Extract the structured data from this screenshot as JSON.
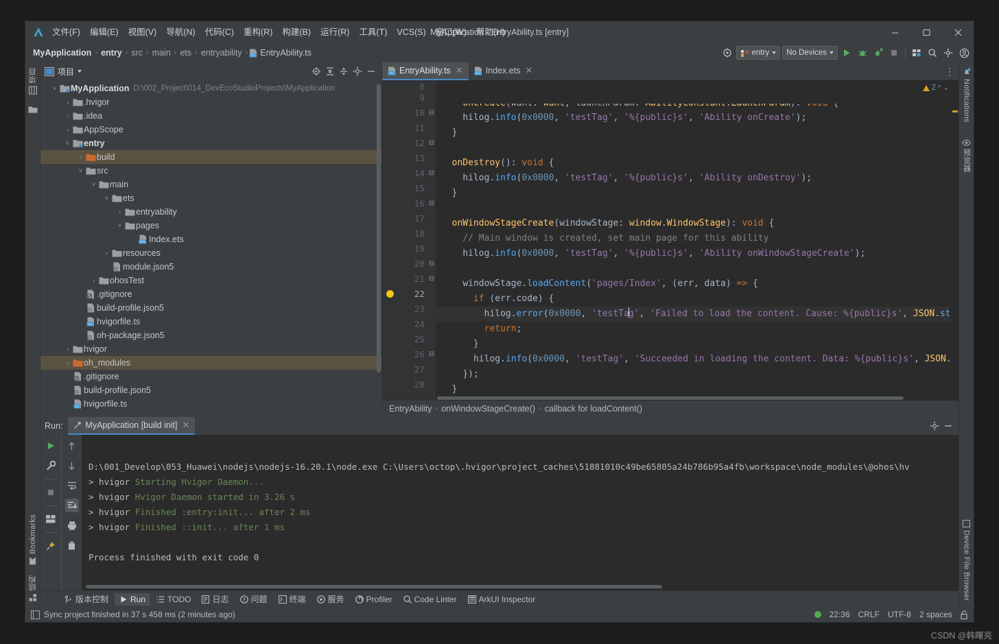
{
  "window": {
    "title": "MyApplication - EntryAbility.ts [entry]",
    "minimize_label": "─",
    "maximize_label": "☐",
    "close_label": "✕"
  },
  "menu": {
    "items": [
      {
        "label": "文件(F)",
        "name": "menu-file"
      },
      {
        "label": "编辑(E)",
        "name": "menu-edit"
      },
      {
        "label": "视图(V)",
        "name": "menu-view"
      },
      {
        "label": "导航(N)",
        "name": "menu-navigate"
      },
      {
        "label": "代码(C)",
        "name": "menu-code"
      },
      {
        "label": "重构(R)",
        "name": "menu-refactor"
      },
      {
        "label": "构建(B)",
        "name": "menu-build"
      },
      {
        "label": "运行(R)",
        "name": "menu-run"
      },
      {
        "label": "工具(T)",
        "name": "menu-tools"
      },
      {
        "label": "VCS(S)",
        "name": "menu-vcs"
      },
      {
        "label": "窗口(W)",
        "name": "menu-window"
      },
      {
        "label": "帮助(H)",
        "name": "menu-help"
      }
    ]
  },
  "navbar": {
    "crumbs": [
      "MyApplication",
      "entry",
      "src",
      "main",
      "ets",
      "entryability"
    ],
    "file": "EntryAbility.ts",
    "separator": "›",
    "run_config": "entry",
    "device": "No Devices"
  },
  "project_panel": {
    "title": "项目",
    "tree": [
      {
        "depth": 0,
        "arrow": "v",
        "icon": "module",
        "label": "MyApplication",
        "bold": true,
        "path": "D:\\002_Project\\014_DevEcoStudioProjects\\MyApplication",
        "selected": false
      },
      {
        "depth": 1,
        "arrow": ">",
        "icon": "folder",
        "label": ".hvigor",
        "bold": false,
        "path": "",
        "selected": false
      },
      {
        "depth": 1,
        "arrow": ">",
        "icon": "folder",
        "label": ".idea",
        "bold": false,
        "path": "",
        "selected": false
      },
      {
        "depth": 1,
        "arrow": ">",
        "icon": "folder",
        "label": "AppScope",
        "bold": false,
        "path": "",
        "selected": false
      },
      {
        "depth": 1,
        "arrow": "v",
        "icon": "module",
        "label": "entry",
        "bold": true,
        "path": "",
        "selected": false
      },
      {
        "depth": 2,
        "arrow": ">",
        "icon": "folder-orange",
        "label": "build",
        "bold": false,
        "path": "",
        "selected": true
      },
      {
        "depth": 2,
        "arrow": "v",
        "icon": "folder",
        "label": "src",
        "bold": false,
        "path": "",
        "selected": false
      },
      {
        "depth": 3,
        "arrow": "v",
        "icon": "folder",
        "label": "main",
        "bold": false,
        "path": "",
        "selected": false
      },
      {
        "depth": 4,
        "arrow": "v",
        "icon": "folder",
        "label": "ets",
        "bold": false,
        "path": "",
        "selected": false
      },
      {
        "depth": 5,
        "arrow": ">",
        "icon": "folder",
        "label": "entryability",
        "bold": false,
        "path": "",
        "selected": false
      },
      {
        "depth": 5,
        "arrow": "v",
        "icon": "folder",
        "label": "pages",
        "bold": false,
        "path": "",
        "selected": false
      },
      {
        "depth": 6,
        "arrow": "",
        "icon": "ets-file",
        "label": "Index.ets",
        "bold": false,
        "path": "",
        "selected": false
      },
      {
        "depth": 4,
        "arrow": ">",
        "icon": "folder",
        "label": "resources",
        "bold": false,
        "path": "",
        "selected": false
      },
      {
        "depth": 4,
        "arrow": "",
        "icon": "json-file",
        "label": "module.json5",
        "bold": false,
        "path": "",
        "selected": false
      },
      {
        "depth": 3,
        "arrow": ">",
        "icon": "folder",
        "label": "ohosTest",
        "bold": false,
        "path": "",
        "selected": false
      },
      {
        "depth": 2,
        "arrow": "",
        "icon": "git-file",
        "label": ".gitignore",
        "bold": false,
        "path": "",
        "selected": false
      },
      {
        "depth": 2,
        "arrow": "",
        "icon": "json-file",
        "label": "build-profile.json5",
        "bold": false,
        "path": "",
        "selected": false
      },
      {
        "depth": 2,
        "arrow": "",
        "icon": "ts-file",
        "label": "hvigorfile.ts",
        "bold": false,
        "path": "",
        "selected": false
      },
      {
        "depth": 2,
        "arrow": "",
        "icon": "json-file",
        "label": "oh-package.json5",
        "bold": false,
        "path": "",
        "selected": false
      },
      {
        "depth": 1,
        "arrow": ">",
        "icon": "folder",
        "label": "hvigor",
        "bold": false,
        "path": "",
        "selected": false
      },
      {
        "depth": 1,
        "arrow": ">",
        "icon": "folder-orange",
        "label": "oh_modules",
        "bold": false,
        "path": "",
        "selected": true
      },
      {
        "depth": 1,
        "arrow": "",
        "icon": "git-file",
        "label": ".gitignore",
        "bold": false,
        "path": "",
        "selected": false
      },
      {
        "depth": 1,
        "arrow": "",
        "icon": "json-file",
        "label": "build-profile.json5",
        "bold": false,
        "path": "",
        "selected": false
      },
      {
        "depth": 1,
        "arrow": "",
        "icon": "ts-file",
        "label": "hvigorfile.ts",
        "bold": false,
        "path": "",
        "selected": false
      }
    ]
  },
  "editor": {
    "tabs": [
      {
        "label": "EntryAbility.ts",
        "icon": "ts-file",
        "active": true
      },
      {
        "label": "Index.ets",
        "icon": "ets-file",
        "active": false
      }
    ],
    "warning_count": "2",
    "line_start": 8,
    "lines": [
      {
        "n": 8,
        "fold": "",
        "marker": "",
        "html": "    <span class='fn'>onCreate</span><span class='bl'>(</span><span class='id'>want</span><span class='bl'>: </span><span class='fn'>Want</span><span class='bl'>, </span><span class='id'>launchParam</span><span class='bl'>: </span><span class='fn'>AbilityConstant</span><span class='bl'>.</span><span class='fn'>LaunchParam</span><span class='bl'>)</span><span class='bl'>: </span><span class='kw'>void</span> <span class='bl'>{</span>",
        "clipped": true
      },
      {
        "n": 9,
        "fold": "",
        "marker": "",
        "html": "    <span class='id'>hilog</span><span class='bl'>.</span><span class='meth'>info</span><span class='bl'>(</span><span class='num'>0x0000</span><span class='bl'>, </span><span class='str'>'testTag'</span><span class='bl'>, </span><span class='str'>'%{public}s'</span><span class='bl'>, </span><span class='str'>'Ability onCreate'</span><span class='bl'>);</span>"
      },
      {
        "n": 10,
        "fold": "-",
        "marker": "",
        "html": "  <span class='bl'>}</span>"
      },
      {
        "n": 11,
        "fold": "",
        "marker": "",
        "html": ""
      },
      {
        "n": 12,
        "fold": "-",
        "marker": "",
        "html": "  <span class='fn'>onDestroy</span><span class='bl'>()</span><span class='bl'>: </span><span class='kw'>void</span> <span class='bl'>{</span>"
      },
      {
        "n": 13,
        "fold": "",
        "marker": "",
        "html": "    <span class='id'>hilog</span><span class='bl'>.</span><span class='meth'>info</span><span class='bl'>(</span><span class='num'>0x0000</span><span class='bl'>, </span><span class='str'>'testTag'</span><span class='bl'>, </span><span class='str'>'%{public}s'</span><span class='bl'>, </span><span class='str'>'Ability onDestroy'</span><span class='bl'>);</span>"
      },
      {
        "n": 14,
        "fold": "-",
        "marker": "",
        "html": "  <span class='bl'>}</span>"
      },
      {
        "n": 15,
        "fold": "",
        "marker": "",
        "html": ""
      },
      {
        "n": 16,
        "fold": "-",
        "marker": "",
        "html": "  <span class='fn'>onWindowStageCreate</span><span class='bl'>(</span><span class='id'>windowStage</span><span class='bl'>: </span><span class='fn'>window</span><span class='bl'>.</span><span class='fn'>WindowStage</span><span class='bl'>)</span><span class='bl'>: </span><span class='kw'>void</span> <span class='bl'>{</span>"
      },
      {
        "n": 17,
        "fold": "",
        "marker": "",
        "html": "    <span class='cmt'>// Main window is created, set main page for this ability</span>"
      },
      {
        "n": 18,
        "fold": "",
        "marker": "",
        "html": "    <span class='id'>hilog</span><span class='bl'>.</span><span class='meth'>info</span><span class='bl'>(</span><span class='num'>0x0000</span><span class='bl'>, </span><span class='str'>'testTag'</span><span class='bl'>, </span><span class='str'>'%{public}s'</span><span class='bl'>, </span><span class='str'>'Ability onWindowStageCreate'</span><span class='bl'>);</span>"
      },
      {
        "n": 19,
        "fold": "",
        "marker": "",
        "html": ""
      },
      {
        "n": 20,
        "fold": "-",
        "marker": "",
        "html": "    <span class='id'>windowStage</span><span class='bl'>.</span><span class='meth'>loadContent</span><span class='bl'>(</span><span class='str'>'pages/Index'</span><span class='bl'>, (</span><span class='id'>err</span><span class='bl'>, </span><span class='id'>data</span><span class='bl'>) </span><span class='kw'>=&gt;</span> <span class='bl'>{</span>"
      },
      {
        "n": 21,
        "fold": "-",
        "marker": "",
        "html": "      <span class='kw'>if</span> <span class='bl'>(</span><span class='id'>err</span><span class='bl'>.</span><span class='id'>code</span><span class='bl'>) {</span>"
      },
      {
        "n": 22,
        "fold": "",
        "marker": "bulb",
        "html": "        <span class='id'>hilog</span><span class='bl'>.</span><span class='meth'>error</span><span class='bl'>(</span><span class='num'>0x0000</span><span class='bl'>, </span><span class='str'>'testTa</span><span class='cursor'></span><span class='str'>g'</span><span class='bl'>, </span><span class='str'>'Failed to load the content. Cause: %{public}s'</span><span class='bl'>, </span><span class='fn'>JSON</span><span class='bl'>.</span><span class='meth'>string</span>",
        "current": true,
        "clipped": true
      },
      {
        "n": 23,
        "fold": "",
        "marker": "",
        "html": "        <span class='kw'>return</span><span class='bl'>;</span>"
      },
      {
        "n": 24,
        "fold": "",
        "marker": "",
        "html": "      <span class='bl'>}</span>"
      },
      {
        "n": 25,
        "fold": "",
        "marker": "",
        "html": "      <span class='id'>hilog</span><span class='bl'>.</span><span class='meth'>info</span><span class='bl'>(</span><span class='num'>0x0000</span><span class='bl'>, </span><span class='str'>'testTag'</span><span class='bl'>, </span><span class='str'>'Succeeded in loading the content. Data: %{public}s'</span><span class='bl'>, </span><span class='fn'>JSON</span><span class='bl'>.</span><span class='meth'>stri</span>",
        "clipped": true
      },
      {
        "n": 26,
        "fold": "-",
        "marker": "",
        "html": "    <span class='bl'>});</span>"
      },
      {
        "n": 27,
        "fold": "",
        "marker": "",
        "html": "  <span class='bl'>}</span>"
      },
      {
        "n": 28,
        "fold": "",
        "marker": "",
        "html": ""
      }
    ],
    "breadcrumbs": [
      "EntryAbility",
      "onWindowStageCreate()",
      "callback for loadContent()"
    ]
  },
  "run_panel": {
    "label": "Run:",
    "tab": "MyApplication [build init]",
    "console": [
      {
        "parts": [
          {
            "t": "D:\\001_Develop\\053_Huawei\\nodejs\\nodejs-16.20.1\\node.exe C:\\Users\\octop\\.hvigor\\project_caches\\51881010c49be65805a24b786b95a4fb\\workspace\\node_modules\\@ohos\\hv",
            "c": "w"
          }
        ]
      },
      {
        "parts": [
          {
            "t": "> hvigor ",
            "c": "w"
          },
          {
            "t": "Starting Hvigor Daemon...",
            "c": "g"
          }
        ]
      },
      {
        "parts": [
          {
            "t": "> hvigor ",
            "c": "w"
          },
          {
            "t": "Hvigor Daemon started in 3.26 s",
            "c": "g"
          }
        ]
      },
      {
        "parts": [
          {
            "t": "> hvigor ",
            "c": "w"
          },
          {
            "t": "Finished :entry:init... after 2 ms",
            "c": "g"
          }
        ]
      },
      {
        "parts": [
          {
            "t": "> hvigor ",
            "c": "w"
          },
          {
            "t": "Finished ::init... after 1 ms",
            "c": "g"
          }
        ]
      },
      {
        "parts": [
          {
            "t": "",
            "c": "w"
          }
        ]
      },
      {
        "parts": [
          {
            "t": "Process finished with exit code 0",
            "c": "w"
          }
        ]
      }
    ]
  },
  "bottom_tabs": [
    {
      "label": "版本控制",
      "icon": "branch-icon",
      "active": false
    },
    {
      "label": "Run",
      "icon": "play-icon",
      "active": true
    },
    {
      "label": "TODO",
      "icon": "list-icon",
      "active": false
    },
    {
      "label": "日志",
      "icon": "log-icon",
      "active": false
    },
    {
      "label": "问题",
      "icon": "problem-icon",
      "active": false
    },
    {
      "label": "终端",
      "icon": "terminal-icon",
      "active": false
    },
    {
      "label": "服务",
      "icon": "service-icon",
      "active": false
    },
    {
      "label": "Profiler",
      "icon": "profiler-icon",
      "active": false
    },
    {
      "label": "Code Linter",
      "icon": "linter-icon",
      "active": false
    },
    {
      "label": "ArkUI Inspector",
      "icon": "inspector-icon",
      "active": false
    }
  ],
  "statusbar": {
    "message": "Sync project finished in 37 s 458 ms (2 minutes ago)",
    "time": "22:36",
    "line_sep": "CRLF",
    "encoding": "UTF-8",
    "indent": "2 spaces"
  },
  "left_strip": {
    "top_label": "项目",
    "bookmarks_label": "Bookmarks",
    "structure_label": "结构"
  },
  "right_strip": {
    "notifications_label": "Notifications",
    "preview_label": "预览器",
    "device_file_browser_label": "Device File Browser"
  },
  "watermark": "CSDN @韩曙亮",
  "colors": {
    "accent": "#4a88c7",
    "selection": "#5b5341",
    "keyword": "#cc7832",
    "string": "#9876aa",
    "number": "#6897bb",
    "function": "#ffc66d",
    "method": "#56a8f5",
    "comment": "#808080",
    "console_green": "#6a8759",
    "status_ok": "#4caf50"
  }
}
